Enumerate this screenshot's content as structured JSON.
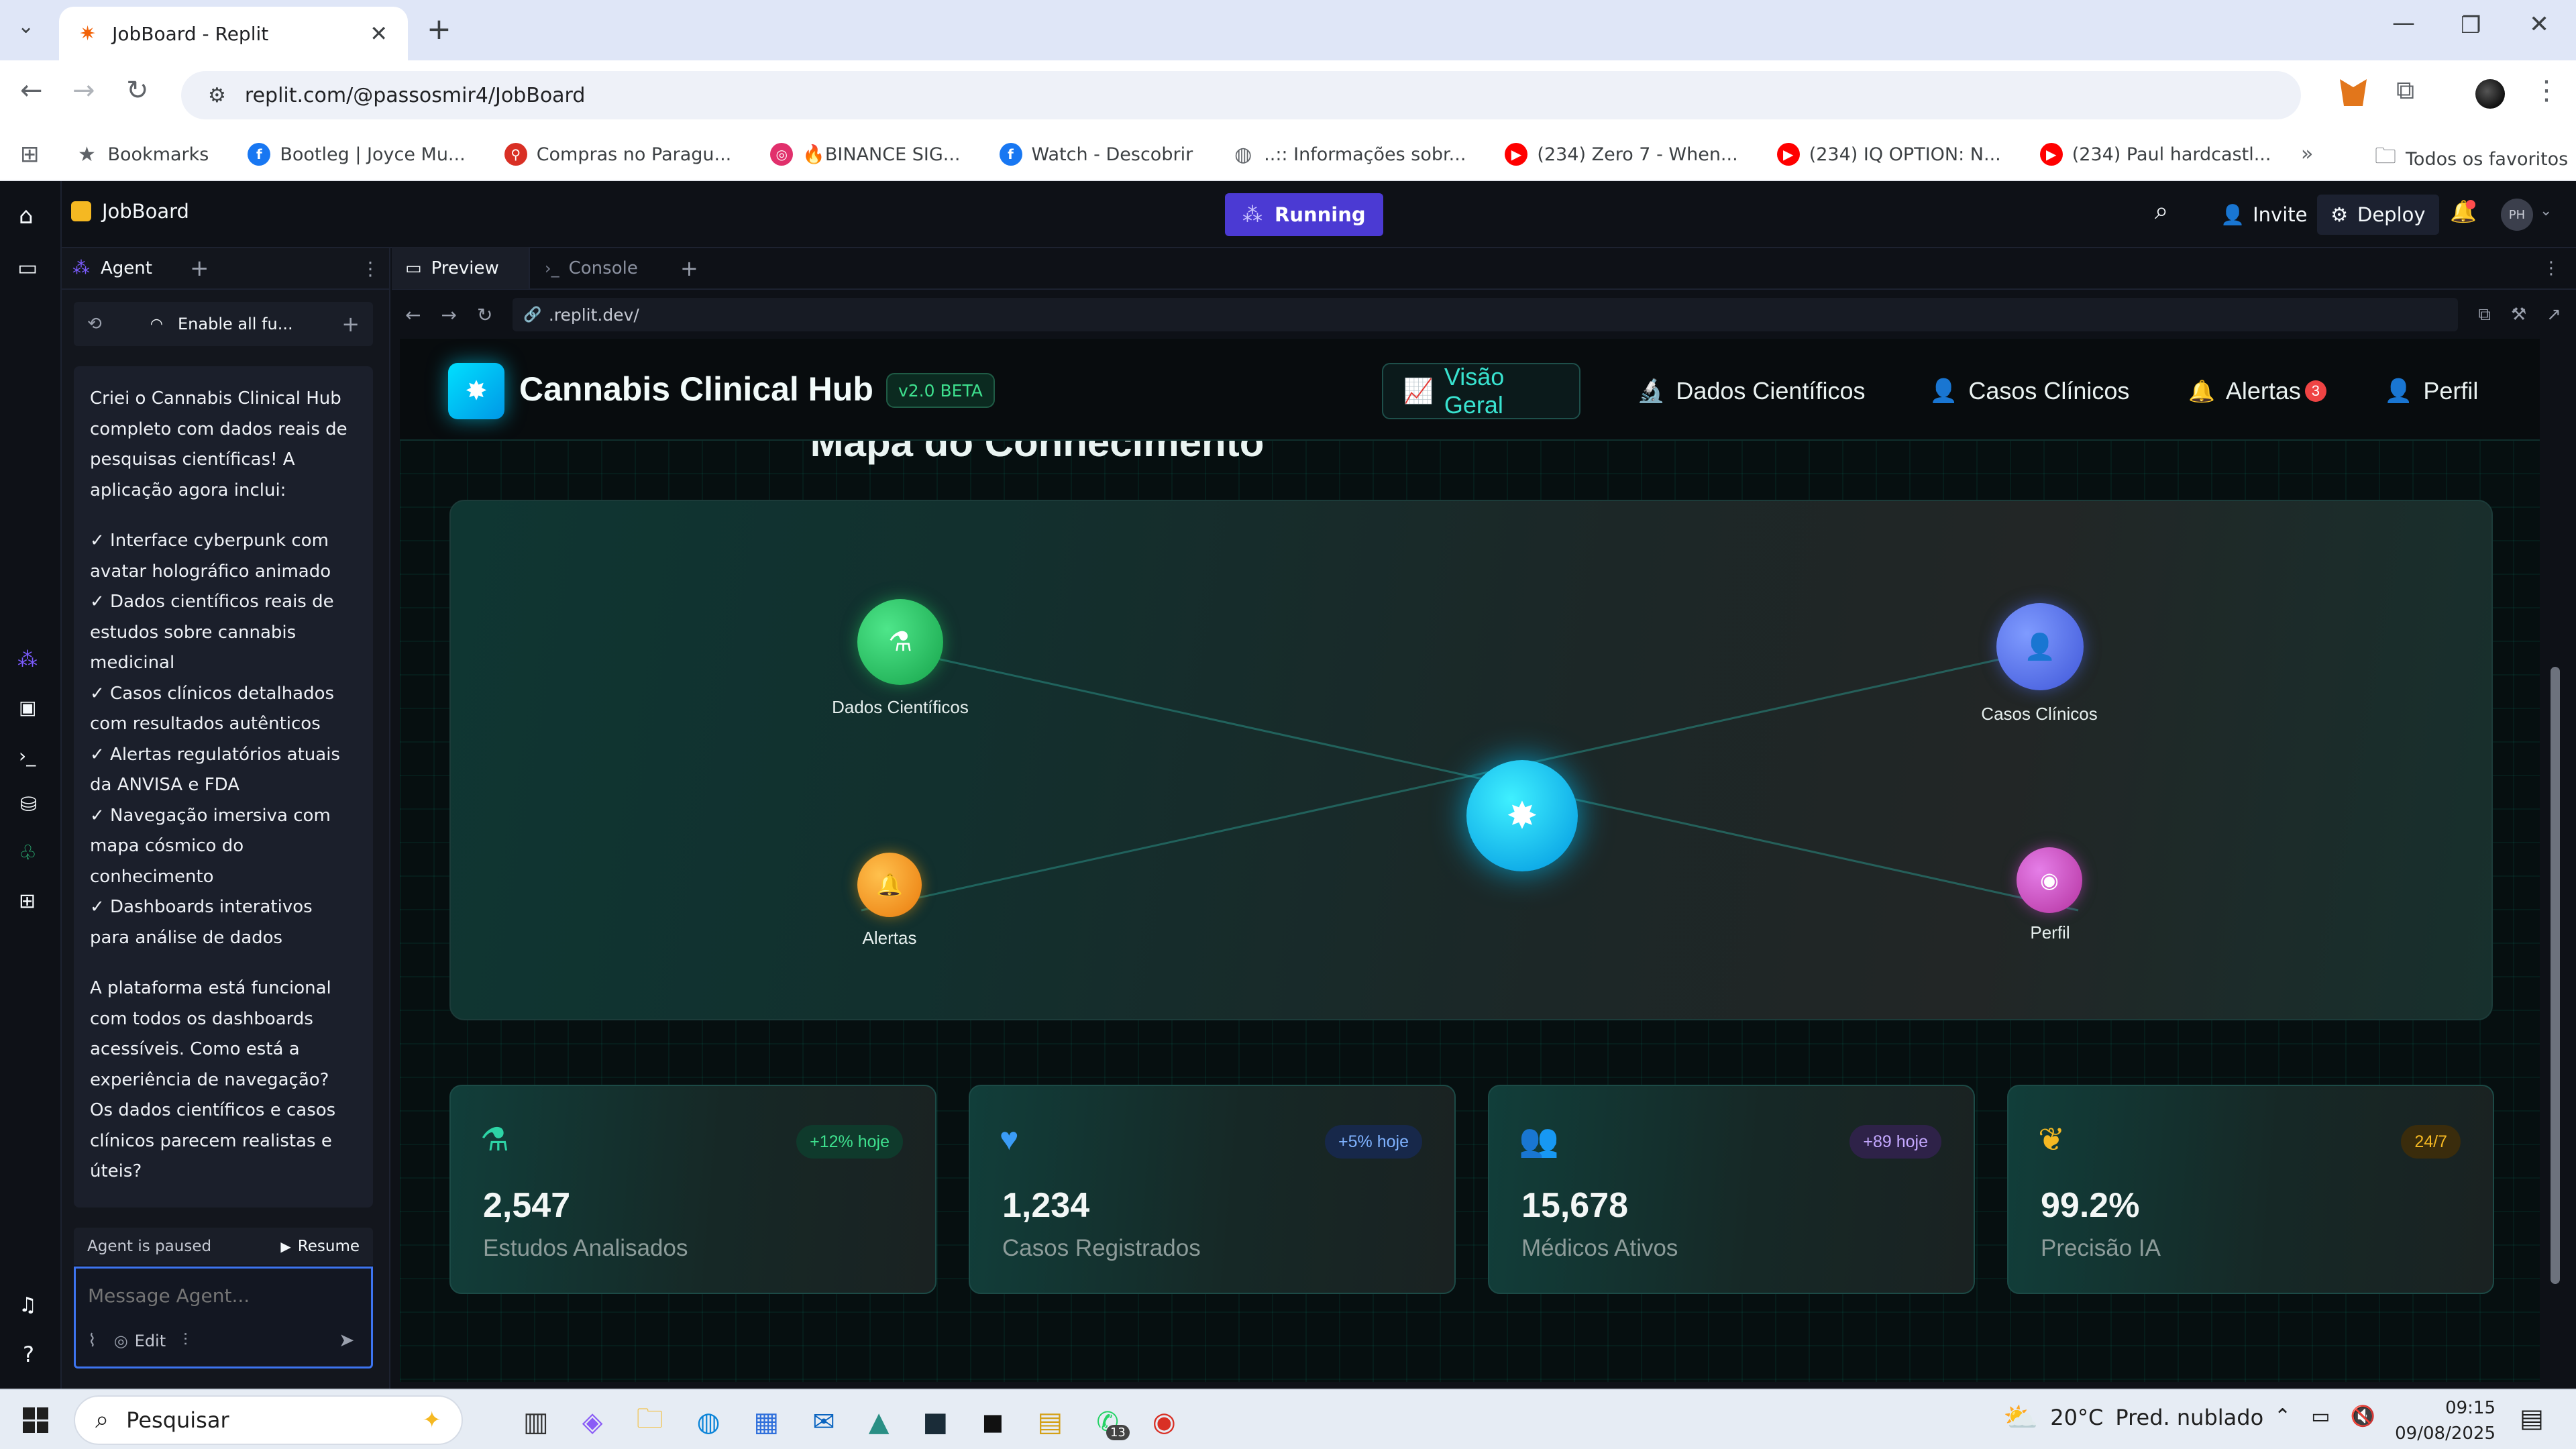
{
  "browser": {
    "tab_title": "JobBoard - Replit",
    "url": "replit.com/@passosmir4/JobBoard",
    "bookmarks": [
      {
        "label": "Bookmarks",
        "icon": "star-icon",
        "color": "#5f6368"
      },
      {
        "label": "Bootleg | Joyce Mu...",
        "icon": "facebook-icon",
        "color": "#1877f2"
      },
      {
        "label": "Compras no Paragu...",
        "icon": "pin-icon",
        "color": "#d93025"
      },
      {
        "label": "🔥BINANCE SIG...",
        "icon": "instagram-icon",
        "color": "#e1306c"
      },
      {
        "label": "Watch - Descobrir",
        "icon": "facebook-icon",
        "color": "#1877f2"
      },
      {
        "label": "..:: Informações sobr...",
        "icon": "globe-icon",
        "color": "#5f6368"
      },
      {
        "label": "(234) Zero 7 - When...",
        "icon": "youtube-icon",
        "color": "#ff0000"
      },
      {
        "label": "(234) IQ OPTION: N...",
        "icon": "youtube-icon",
        "color": "#ff0000"
      },
      {
        "label": "(234) Paul hardcastl...",
        "icon": "youtube-icon",
        "color": "#ff0000"
      }
    ],
    "all_bookmarks": "Todos os favoritos"
  },
  "replit": {
    "project": "JobBoard",
    "status": "Running",
    "invite": "Invite",
    "deploy": "Deploy",
    "avatar": "PH",
    "agent_tab": "Agent",
    "enable_label": "Enable all fu...",
    "preview_tab": "Preview",
    "console_tab": "Console",
    "preview_url": ".replit.dev/",
    "agent_message": [
      "Criei o Cannabis Clinical Hub completo com dados reais de pesquisas científicas! A aplicação agora inclui:",
      "✓ Interface cyberpunk com avatar holográfico animado",
      "✓ Dados científicos reais de estudos sobre cannabis medicinal",
      "✓ Casos clínicos detalhados com resultados autênticos",
      "✓ Alertas regulatórios atuais da ANVISA e FDA",
      "✓ Navegação imersiva com mapa cósmico do conhecimento",
      "✓ Dashboards interativos para análise de dados",
      "A plataforma está funcional com todos os dashboards acessíveis. Como está a experiência de navegação? Os dados científicos e casos clínicos parecem realistas e úteis?"
    ],
    "paused_label": "Agent is paused",
    "resume_label": "Resume",
    "message_placeholder": "Message Agent...",
    "edit_label": "Edit"
  },
  "app": {
    "title": "Cannabis Clinical Hub",
    "version": "v2.0 BETA",
    "nav": [
      {
        "label": "Visão Geral",
        "icon": "chart-line-icon"
      },
      {
        "label": "Dados Científicos",
        "icon": "microscope-icon"
      },
      {
        "label": "Casos Clínicos",
        "icon": "doctor-icon"
      },
      {
        "label": "Alertas",
        "icon": "bell-icon",
        "badge": "3"
      },
      {
        "label": "Perfil",
        "icon": "user-circle-icon"
      }
    ],
    "section_title": "Mapa do Conhecimento",
    "map_nodes": [
      {
        "label": "Dados Científicos",
        "color": "#22c55e"
      },
      {
        "label": "Casos Clínicos",
        "color": "#4f6ef0"
      },
      {
        "label": "Alertas",
        "color": "#f59e0b"
      },
      {
        "label": "Perfil",
        "color": "#c545c8"
      }
    ],
    "stats": [
      {
        "value": "2,547",
        "label": "Estudos Analisados",
        "badge": "+12% hoje",
        "icon": "flask-icon",
        "color": "#2dd4a6"
      },
      {
        "value": "1,234",
        "label": "Casos Registrados",
        "badge": "+5% hoje",
        "icon": "heartbeat-icon",
        "color": "#3b9cf6"
      },
      {
        "value": "15,678",
        "label": "Médicos Ativos",
        "badge": "+89 hoje",
        "icon": "users-icon",
        "color": "#a78bfa"
      },
      {
        "value": "99.2%",
        "label": "Precisão IA",
        "badge": "24/7",
        "icon": "brain-icon",
        "color": "#f5b822"
      }
    ]
  },
  "taskbar": {
    "search": "Pesquisar",
    "weather_temp": "20°C",
    "weather_desc": "Pred. nublado",
    "time": "09:15",
    "date": "09/08/2025",
    "whatsapp_badge": "13"
  }
}
